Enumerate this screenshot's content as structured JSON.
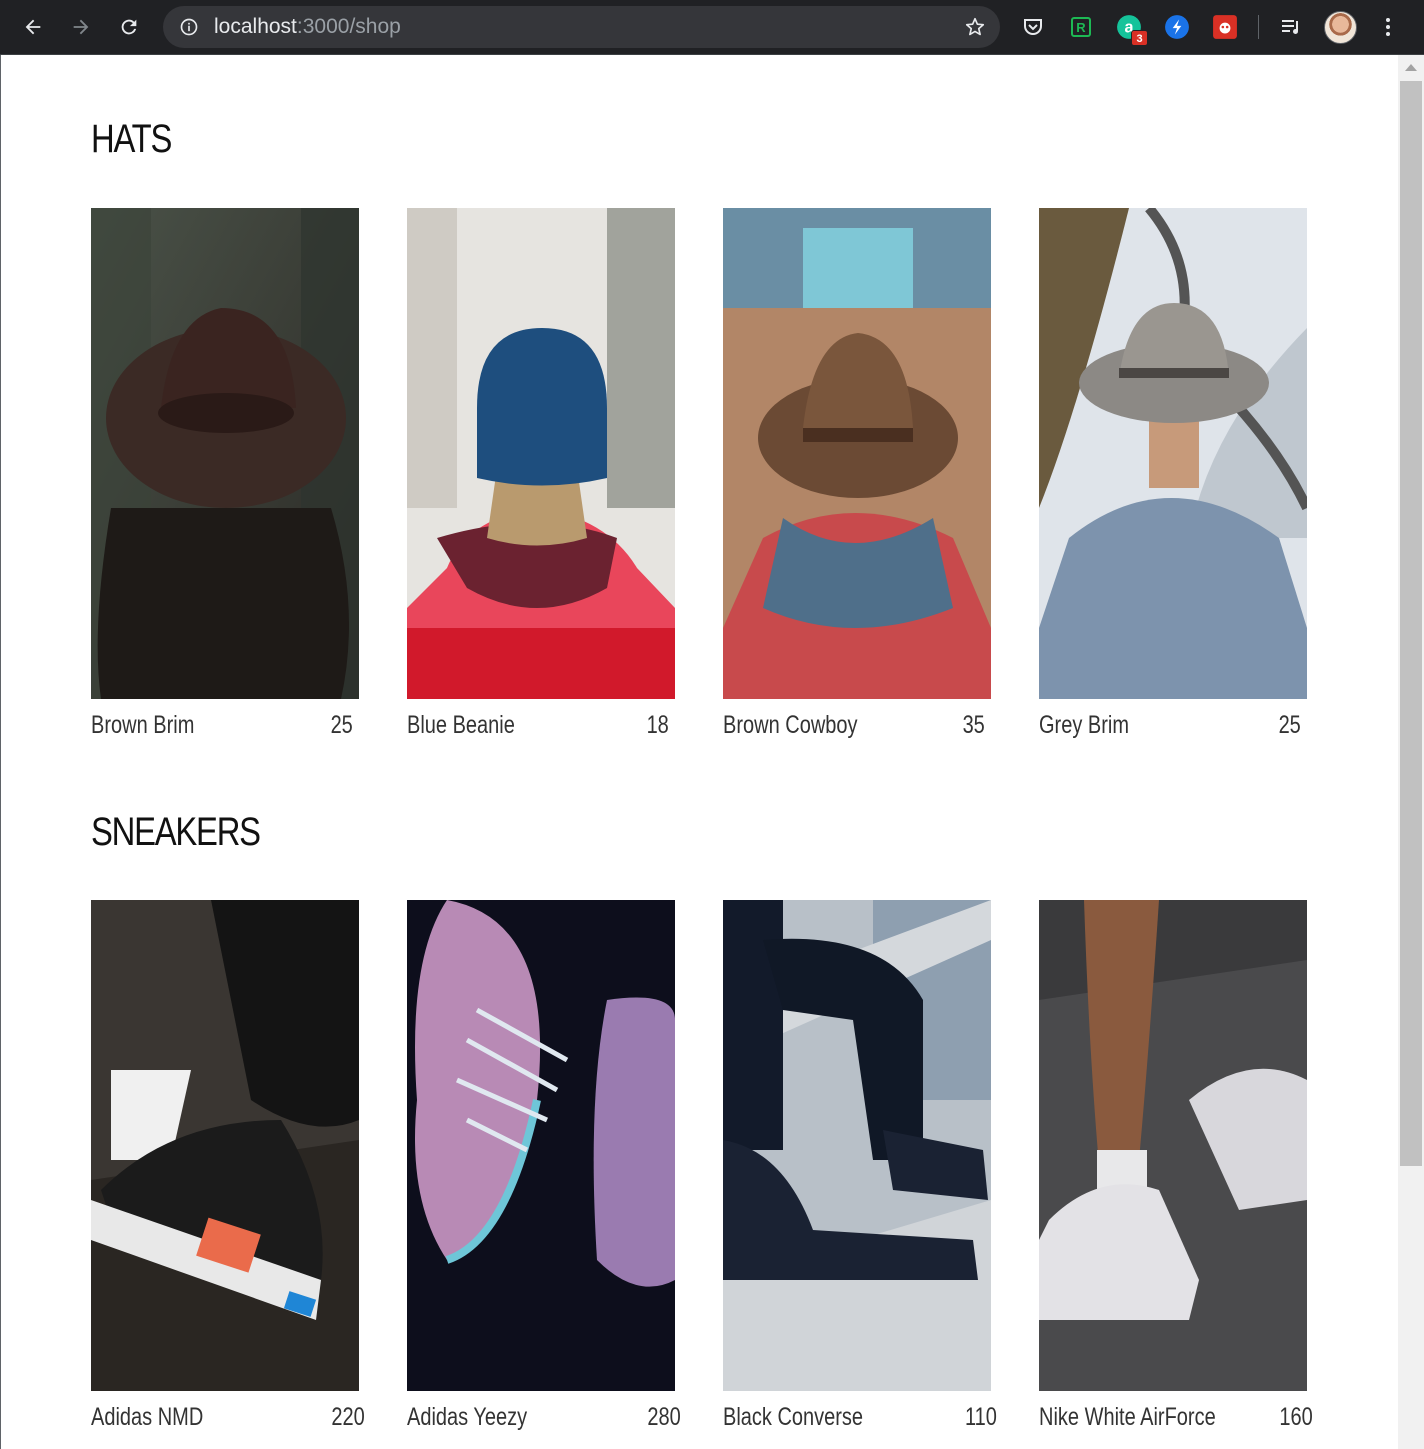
{
  "browser": {
    "url_host": "localhost",
    "url_path": ":3000/shop",
    "extensions": [
      {
        "name": "pocket-icon"
      },
      {
        "name": "rss-extension-icon"
      },
      {
        "name": "grammarly-icon",
        "badge": "3"
      },
      {
        "name": "shield-extension-icon"
      },
      {
        "name": "bug-extension-icon"
      }
    ]
  },
  "collections": [
    {
      "title": "HATS",
      "items": [
        {
          "name": "Brown Brim",
          "price": "25"
        },
        {
          "name": "Blue Beanie",
          "price": "18"
        },
        {
          "name": "Brown Cowboy",
          "price": "35"
        },
        {
          "name": "Grey Brim",
          "price": "25"
        }
      ]
    },
    {
      "title": "SNEAKERS",
      "items": [
        {
          "name": "Adidas NMD",
          "price": "220"
        },
        {
          "name": "Adidas Yeezy",
          "price": "280"
        },
        {
          "name": "Black Converse",
          "price": "110"
        },
        {
          "name": "Nike White AirForce",
          "price": "160"
        }
      ]
    }
  ]
}
